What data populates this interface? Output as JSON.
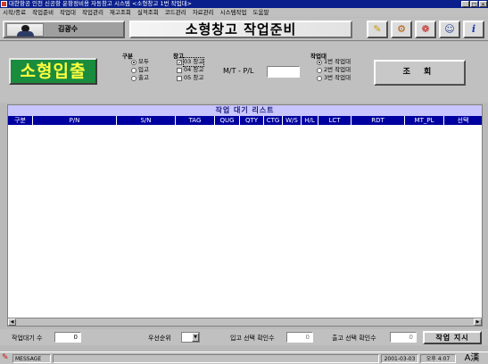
{
  "window": {
    "title": "대한항공 인천 신공항 운항정비용 자동창고 시스템 <소형창고 1번 작업대>",
    "buttons": [
      "_",
      "□",
      "×"
    ]
  },
  "menu": [
    "시작/종료",
    "작업준비",
    "작업대",
    "작업관리",
    "재고조회",
    "실적조회",
    "코드관리",
    "자료관리",
    "시스템작업",
    "도움말"
  ],
  "header": {
    "user_name": "김광수",
    "page_title": "소형창고 작업준비",
    "tool_icons": [
      "notepad-icon",
      "gear-icon",
      "palette-icon",
      "users-icon",
      "info-icon"
    ],
    "tool_glyphs": [
      "✎",
      "⚙",
      "❁",
      "☺",
      "i"
    ]
  },
  "panel": {
    "logo_text": "소형입출",
    "type_group": {
      "label": "구분",
      "options": [
        {
          "label": "모두",
          "selected": true
        },
        {
          "label": "입고",
          "selected": false
        },
        {
          "label": "출고",
          "selected": false
        }
      ]
    },
    "warehouse_group": {
      "label": "창고",
      "options": [
        {
          "label": "03 창고",
          "checked": true
        },
        {
          "label": "04 창고",
          "checked": false
        },
        {
          "label": "05 창고",
          "checked": false
        }
      ]
    },
    "mtpl_label": "M/T - P/L",
    "mtpl_value": "",
    "workbench_group": {
      "label": "작업대",
      "options": [
        {
          "label": "1번 작업대",
          "selected": true
        },
        {
          "label": "2번 작업대",
          "selected": false
        },
        {
          "label": "3번 작업대",
          "selected": false
        }
      ]
    },
    "query_button": "조 회"
  },
  "list": {
    "title": "작업 대기 리스트",
    "columns": [
      "구분",
      "P/N",
      "S/N",
      "TAG",
      "QUG",
      "QTY",
      "CTG",
      "W/S",
      "H/L",
      "LCT",
      "RDT",
      "MT_PL",
      "선택"
    ],
    "rows": []
  },
  "bottom": {
    "waiting_label": "작업대기 수",
    "waiting_count": "0",
    "priority_label": "우선순위",
    "priority_value": "",
    "in_select_label": "입고 선택 확인수",
    "in_select_count": "0",
    "out_select_label": "출고 선택 확인수",
    "out_select_count": "0",
    "work_button": "작업 지시"
  },
  "status": {
    "message": "MESSAGE",
    "date": "2001-03-03",
    "time": "오후 4:07",
    "ime": "A漢"
  }
}
